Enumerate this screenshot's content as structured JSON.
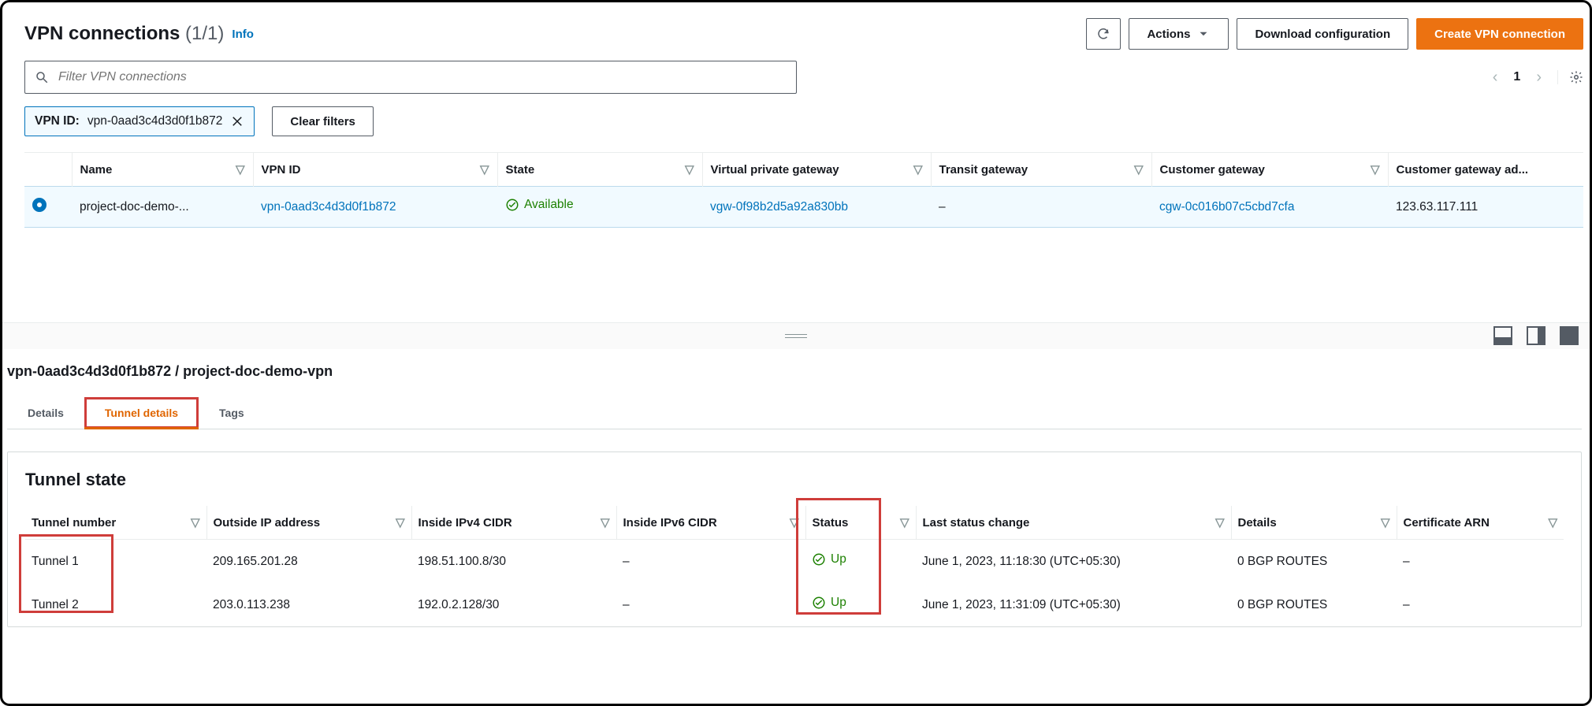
{
  "header": {
    "title": "VPN connections",
    "count": "(1/1)",
    "info_label": "Info",
    "refresh_title": "Refresh",
    "actions_label": "Actions",
    "download_label": "Download configuration",
    "create_label": "Create VPN connection"
  },
  "search": {
    "placeholder": "Filter VPN connections"
  },
  "pager": {
    "page": "1"
  },
  "filter_chip": {
    "key": "VPN ID:",
    "value": "vpn-0aad3c4d3d0f1b872"
  },
  "clear_filters_label": "Clear filters",
  "table": {
    "columns": {
      "name": "Name",
      "vpn_id": "VPN ID",
      "state": "State",
      "vgw": "Virtual private gateway",
      "tgw": "Transit gateway",
      "cgw": "Customer gateway",
      "cgw_addr": "Customer gateway ad..."
    },
    "row": {
      "name": "project-doc-demo-...",
      "vpn_id": "vpn-0aad3c4d3d0f1b872",
      "state": "Available",
      "vgw": "vgw-0f98b2d5a92a830bb",
      "tgw": "–",
      "cgw": "cgw-0c016b07c5cbd7cfa",
      "cgw_addr": "123.63.117.111"
    }
  },
  "detail": {
    "breadcrumb": "vpn-0aad3c4d3d0f1b872 / project-doc-demo-vpn",
    "tabs": {
      "details": "Details",
      "tunnel": "Tunnel details",
      "tags": "Tags"
    },
    "card_title": "Tunnel state",
    "tunnel_columns": {
      "num": "Tunnel number",
      "outside": "Outside IP address",
      "inside4": "Inside IPv4 CIDR",
      "inside6": "Inside IPv6 CIDR",
      "status": "Status",
      "last": "Last status change",
      "details": "Details",
      "cert": "Certificate ARN"
    },
    "tunnels": [
      {
        "num": "Tunnel 1",
        "outside": "209.165.201.28",
        "inside4": "198.51.100.8/30",
        "inside6": "–",
        "status": "Up",
        "last": "June 1, 2023, 11:18:30 (UTC+05:30)",
        "details": "0 BGP ROUTES",
        "cert": "–"
      },
      {
        "num": "Tunnel 2",
        "outside": "203.0.113.238",
        "inside4": "192.0.2.128/30",
        "inside6": "–",
        "status": "Up",
        "last": "June 1, 2023, 11:31:09 (UTC+05:30)",
        "details": "0 BGP ROUTES",
        "cert": "–"
      }
    ]
  }
}
